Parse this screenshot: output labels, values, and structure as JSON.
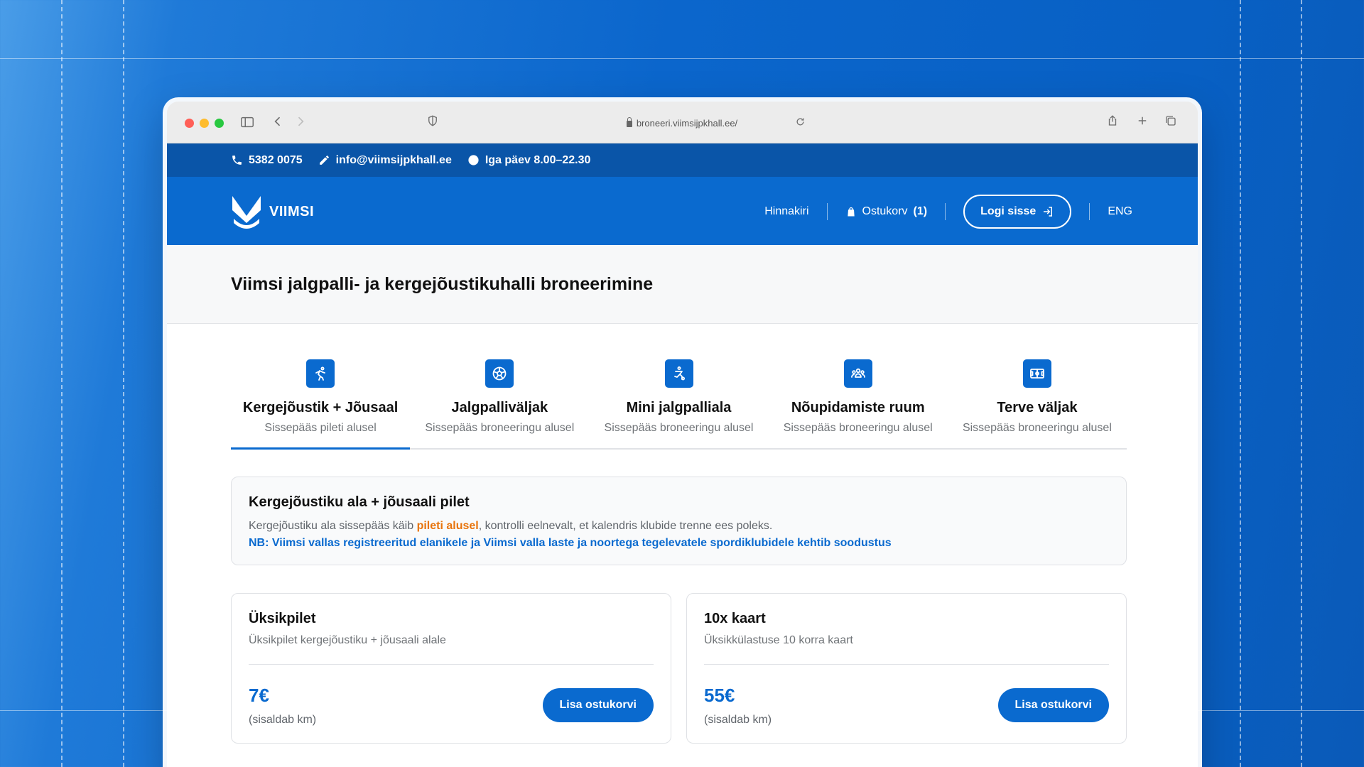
{
  "browser": {
    "url": "broneeri.viimsijpkhall.ee/"
  },
  "infobar": {
    "phone": "5382 0075",
    "email": "info@viimsijpkhall.ee",
    "hours": "Iga päev 8.00–22.30"
  },
  "nav": {
    "logo_text": "VIIMSI",
    "pricelist": "Hinnakiri",
    "cart": "Ostukorv",
    "cart_count": "(1)",
    "login": "Logi sisse",
    "language": "ENG"
  },
  "page": {
    "title": "Viimsi jalgpalli- ja kergejõustikuhalli broneerimine"
  },
  "tabs": [
    {
      "label": "Kergejõustik + Jõusaal",
      "sub": "Sissepääs pileti alusel",
      "icon": "runner-icon"
    },
    {
      "label": "Jalgpalliväljak",
      "sub": "Sissepääs broneeringu alusel",
      "icon": "soccer-ball-icon"
    },
    {
      "label": "Mini jalgpalliala",
      "sub": "Sissepääs broneeringu alusel",
      "icon": "player-kick-icon"
    },
    {
      "label": "Nõupidamiste ruum",
      "sub": "Sissepääs broneeringu alusel",
      "icon": "people-group-icon"
    },
    {
      "label": "Terve väljak",
      "sub": "Sissepääs broneeringu alusel",
      "icon": "field-icon"
    }
  ],
  "notice": {
    "title": "Kergejõustiku ala + jõusaali pilet",
    "text_before": "Kergejõustiku ala sissepääs käib ",
    "highlight": "pileti alusel",
    "text_after": ", kontrolli eelnevalt, et kalendris klubide trenne ees poleks.",
    "nb": "NB: Viimsi vallas registreeritud elanikele ja Viimsi valla laste ja noortega tegelevatele spordiklubidele kehtib soodustus"
  },
  "cards": [
    {
      "title": "Üksikpilet",
      "desc": "Üksikpilet kergejõustiku + jõusaali alale",
      "price": "7€",
      "vat": "(sisaldab km)",
      "button": "Lisa ostukorvi"
    },
    {
      "title": "10x kaart",
      "desc": "Üksikkülastuse 10 korra kaart",
      "price": "55€",
      "vat": "(sisaldab km)",
      "button": "Lisa ostukorvi"
    }
  ],
  "colors": {
    "primary": "#0a6acf",
    "infobar": "#0a55a8",
    "highlight": "#e8740c"
  }
}
